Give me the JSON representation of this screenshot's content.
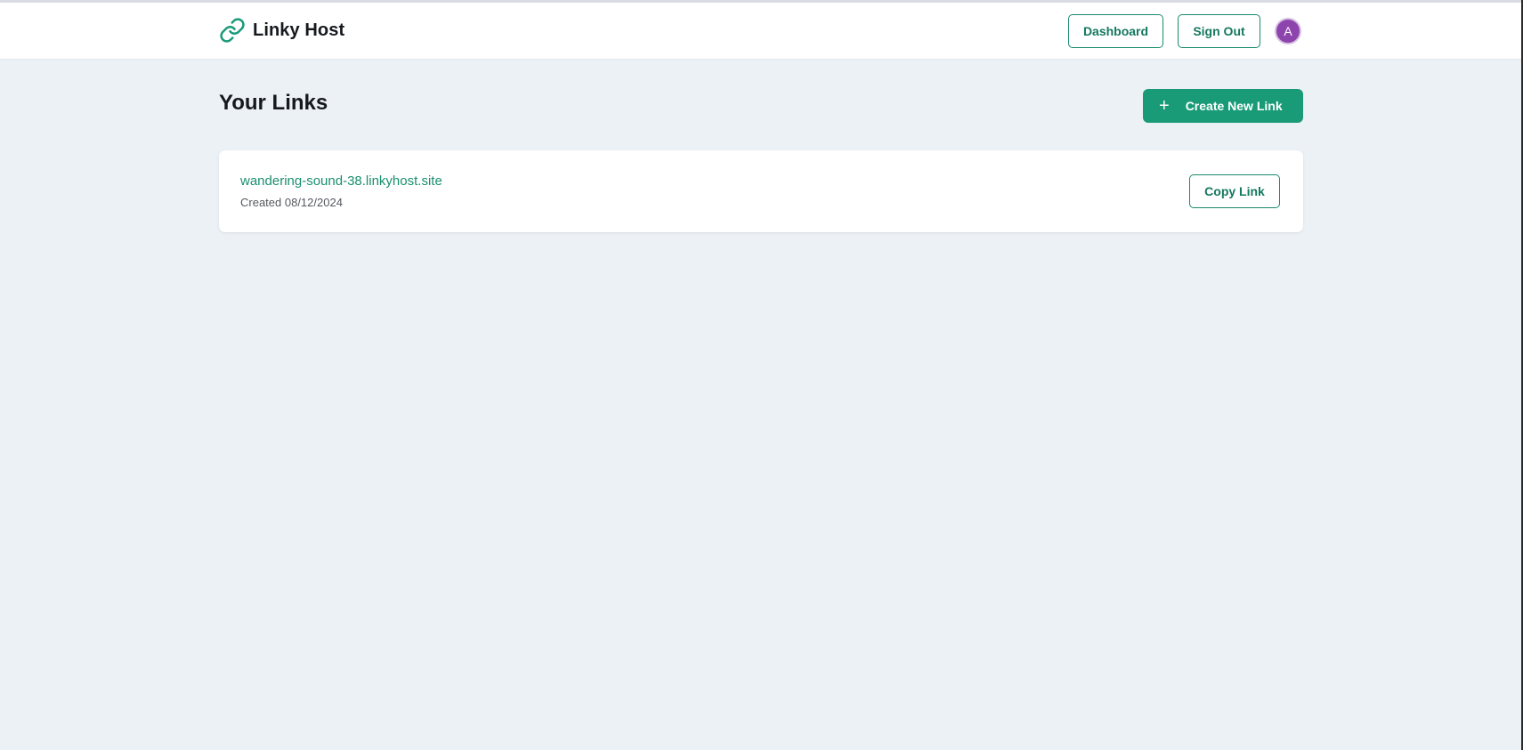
{
  "colors": {
    "accent": "#1a9b78",
    "accent_text": "#14785f",
    "background": "#ecf1f5",
    "avatar": "#8e44ad"
  },
  "header": {
    "brand_icon": "link-chain-icon",
    "brand_name": "Linky Host",
    "dashboard_label": "Dashboard",
    "signout_label": "Sign Out",
    "avatar_initial": "A"
  },
  "main": {
    "title": "Your Links",
    "create_button": {
      "icon": "plus-icon",
      "icon_glyph": "+",
      "label": "Create New Link"
    },
    "links": [
      {
        "url": "wandering-sound-38.linkyhost.site",
        "created": "Created 08/12/2024",
        "copy_label": "Copy Link"
      }
    ]
  }
}
